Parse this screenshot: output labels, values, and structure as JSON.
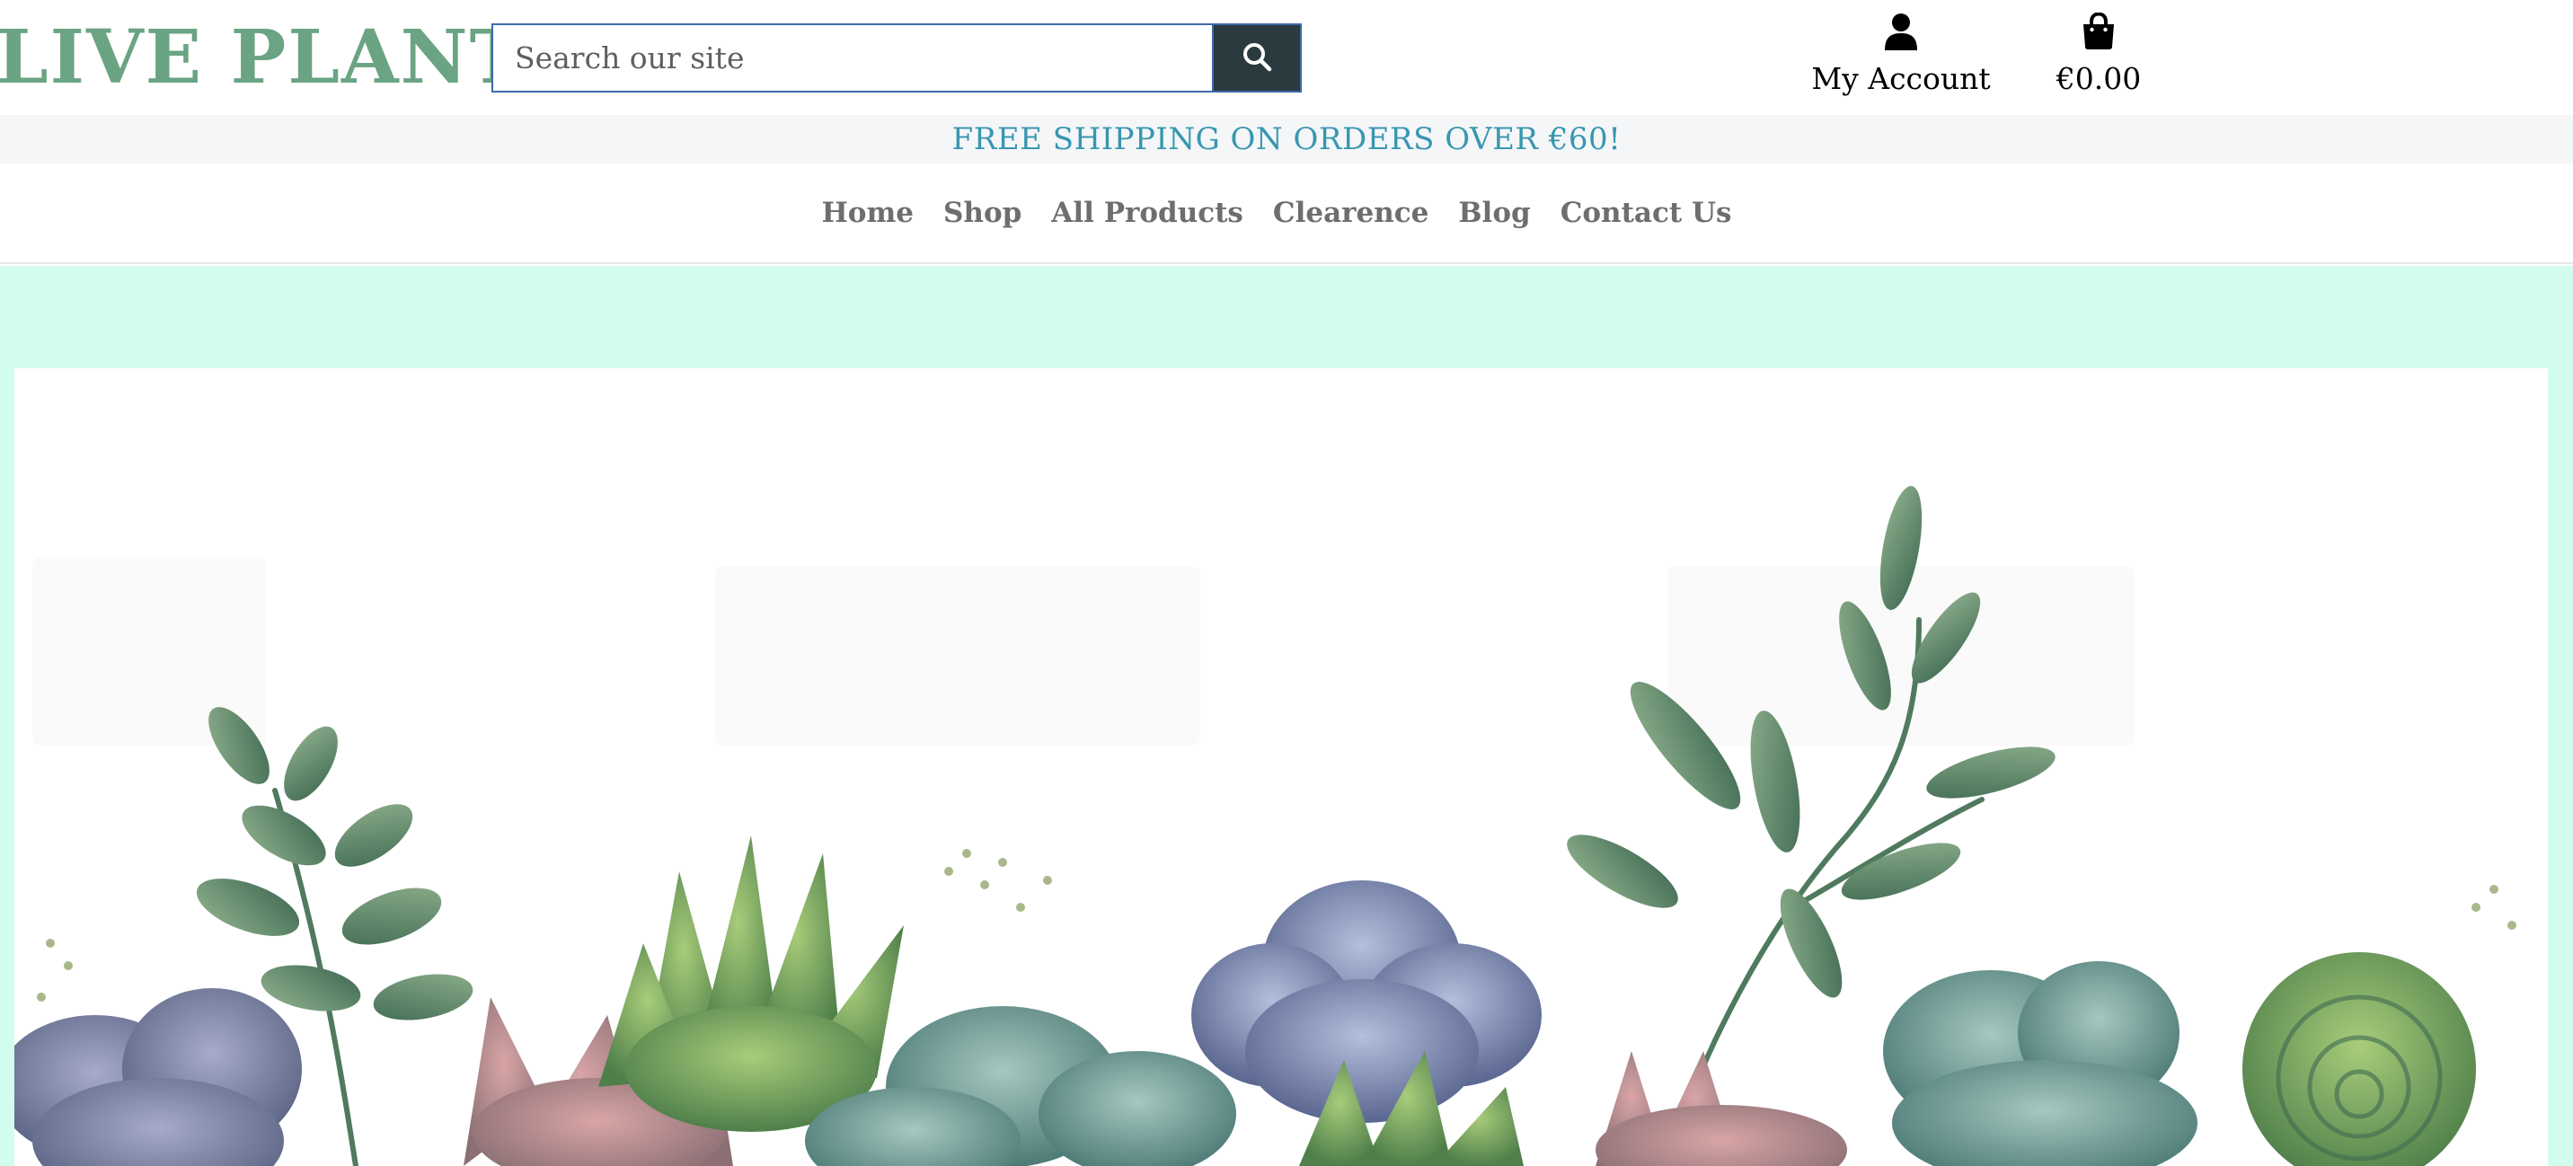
{
  "header": {
    "logo_text": "LIVE PLANTS",
    "search": {
      "placeholder": "Search our site",
      "value": "",
      "button_icon": "search-icon"
    },
    "account": {
      "icon": "user-icon",
      "label": "My Account"
    },
    "cart": {
      "icon": "shopping-bag-icon",
      "label": "€0.00"
    }
  },
  "banner": {
    "text": "FREE SHIPPING ON ORDERS OVER €60!"
  },
  "nav": {
    "items": [
      {
        "label": "Home"
      },
      {
        "label": "Shop"
      },
      {
        "label": "All Products"
      },
      {
        "label": "Clearence"
      },
      {
        "label": "Blog"
      },
      {
        "label": "Contact Us"
      }
    ]
  },
  "hero": {
    "image": "succulents-watercolor-illustration"
  },
  "colors": {
    "logo": "#6aa482",
    "search_border": "#3c6aa8",
    "search_button": "#2b3a3f",
    "banner_text": "#3797b0",
    "banner_bg": "#f5f6f8",
    "nav_text": "#6e6e6e",
    "main_bg": "#d2fcee"
  }
}
